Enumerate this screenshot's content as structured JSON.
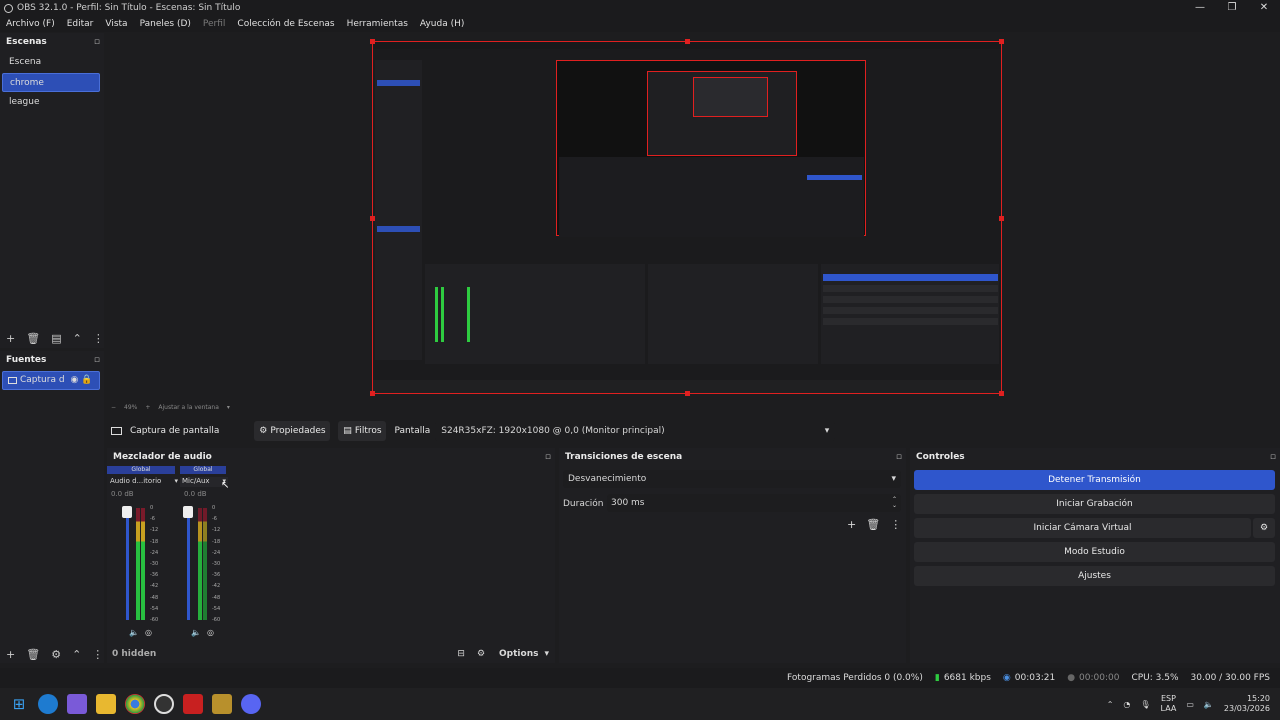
{
  "window": {
    "title": "OBS 32.1.0 - Perfil: Sin Título - Escenas: Sin Título",
    "controls": [
      "—",
      "❐",
      "✕"
    ]
  },
  "menu": [
    {
      "label": "Archivo (F)",
      "enabled": true
    },
    {
      "label": "Editar",
      "enabled": true
    },
    {
      "label": "Vista",
      "enabled": true
    },
    {
      "label": "Paneles (D)",
      "enabled": true
    },
    {
      "label": "Perfil",
      "enabled": false
    },
    {
      "label": "Colección de Escenas",
      "enabled": true
    },
    {
      "label": "Herramientas",
      "enabled": true
    },
    {
      "label": "Ayuda (H)",
      "enabled": true
    }
  ],
  "scenes": {
    "title": "Escenas",
    "items": [
      "Escena",
      "chrome",
      "league"
    ],
    "active": 1
  },
  "sources": {
    "title": "Fuentes",
    "items": [
      "Captura d"
    ]
  },
  "zoom": {
    "value": "49%",
    "fit_label": "Ajustar a la ventana"
  },
  "source_toolbar": {
    "source_name": "Captura de pantalla",
    "properties": "Propiedades",
    "filters": "Filtros",
    "screen_label": "Pantalla",
    "screen_value": "S24R35xFZ: 1920x1080 @ 0,0 (Monitor principal)"
  },
  "mixer": {
    "title": "Mezclador de audio",
    "channels": [
      {
        "global": "Global",
        "name": "Audio d...itorio",
        "db": "0.0 dB"
      },
      {
        "global": "Global",
        "name": "Mic/Aux",
        "db": "0.0 dB"
      }
    ],
    "scale": [
      "0",
      "-6",
      "-12",
      "-18",
      "-24",
      "-30",
      "-36",
      "-42",
      "-48",
      "-54",
      "-60"
    ],
    "hidden": "0 hidden",
    "options": "Options"
  },
  "transitions": {
    "title": "Transiciones de escena",
    "type": "Desvanecimiento",
    "duration_label": "Duración",
    "duration_value": "300 ms"
  },
  "controls": {
    "title": "Controles",
    "stop_stream": "Detener Transmisión",
    "start_record": "Iniciar Grabación",
    "virtual_cam": "Iniciar Cámara Virtual",
    "studio": "Modo Estudio",
    "settings": "Ajustes"
  },
  "status": {
    "dropped": "Fotogramas Perdidos 0 (0.0%)",
    "bitrate": "6681 kbps",
    "stream_time": "00:03:21",
    "rec_time": "00:00:00",
    "cpu": "CPU: 3.5%",
    "fps": "30.00 / 30.00 FPS"
  },
  "taskbar": {
    "lang1": "ESP",
    "lang2": "LAA",
    "time": "15:20",
    "date": "23/03/2026"
  },
  "colors": {
    "accent": "#2f56cc",
    "selection_red": "#e02020",
    "panel": "#1f1f22",
    "bg": "#1d1d1f"
  }
}
